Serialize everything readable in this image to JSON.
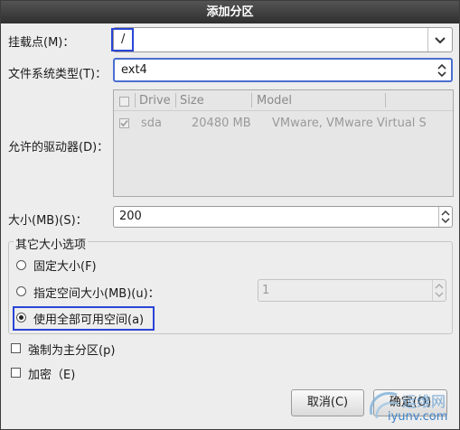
{
  "dialog": {
    "title": "添加分区"
  },
  "mount_point": {
    "label": "挂载点(M)：",
    "value": "/"
  },
  "fs_type": {
    "label": "文件系统类型(T)：",
    "value": "ext4"
  },
  "drives": {
    "label": "允许的驱动器(D)：",
    "columns": [
      "Drive",
      "Size",
      "Model"
    ],
    "rows": [
      {
        "drive": "sda",
        "size": "20480 MB",
        "model": "VMware, VMware Virtual S",
        "checked": true
      }
    ]
  },
  "size": {
    "label": "大小(MB)(S)：",
    "value": "200"
  },
  "other_size": {
    "title": "其它大小选项",
    "fixed": "固定大小(F)",
    "up_to": "指定空间大小(MB)(u)：",
    "up_to_value": "1",
    "fill_all": "使用全部可用空间(a)",
    "selected": "fill_all"
  },
  "force_primary": {
    "label": "強制为主分区(p)",
    "checked": false
  },
  "encrypt": {
    "label": "加密（E)",
    "checked": false
  },
  "buttons": {
    "cancel": "取消(C)",
    "ok": "确定(O)"
  },
  "watermark": {
    "line1": "运维网",
    "line2": "iyunv.com"
  },
  "colors": {
    "highlight": "#2a45d6",
    "titlebar": "#3a3a3a"
  }
}
